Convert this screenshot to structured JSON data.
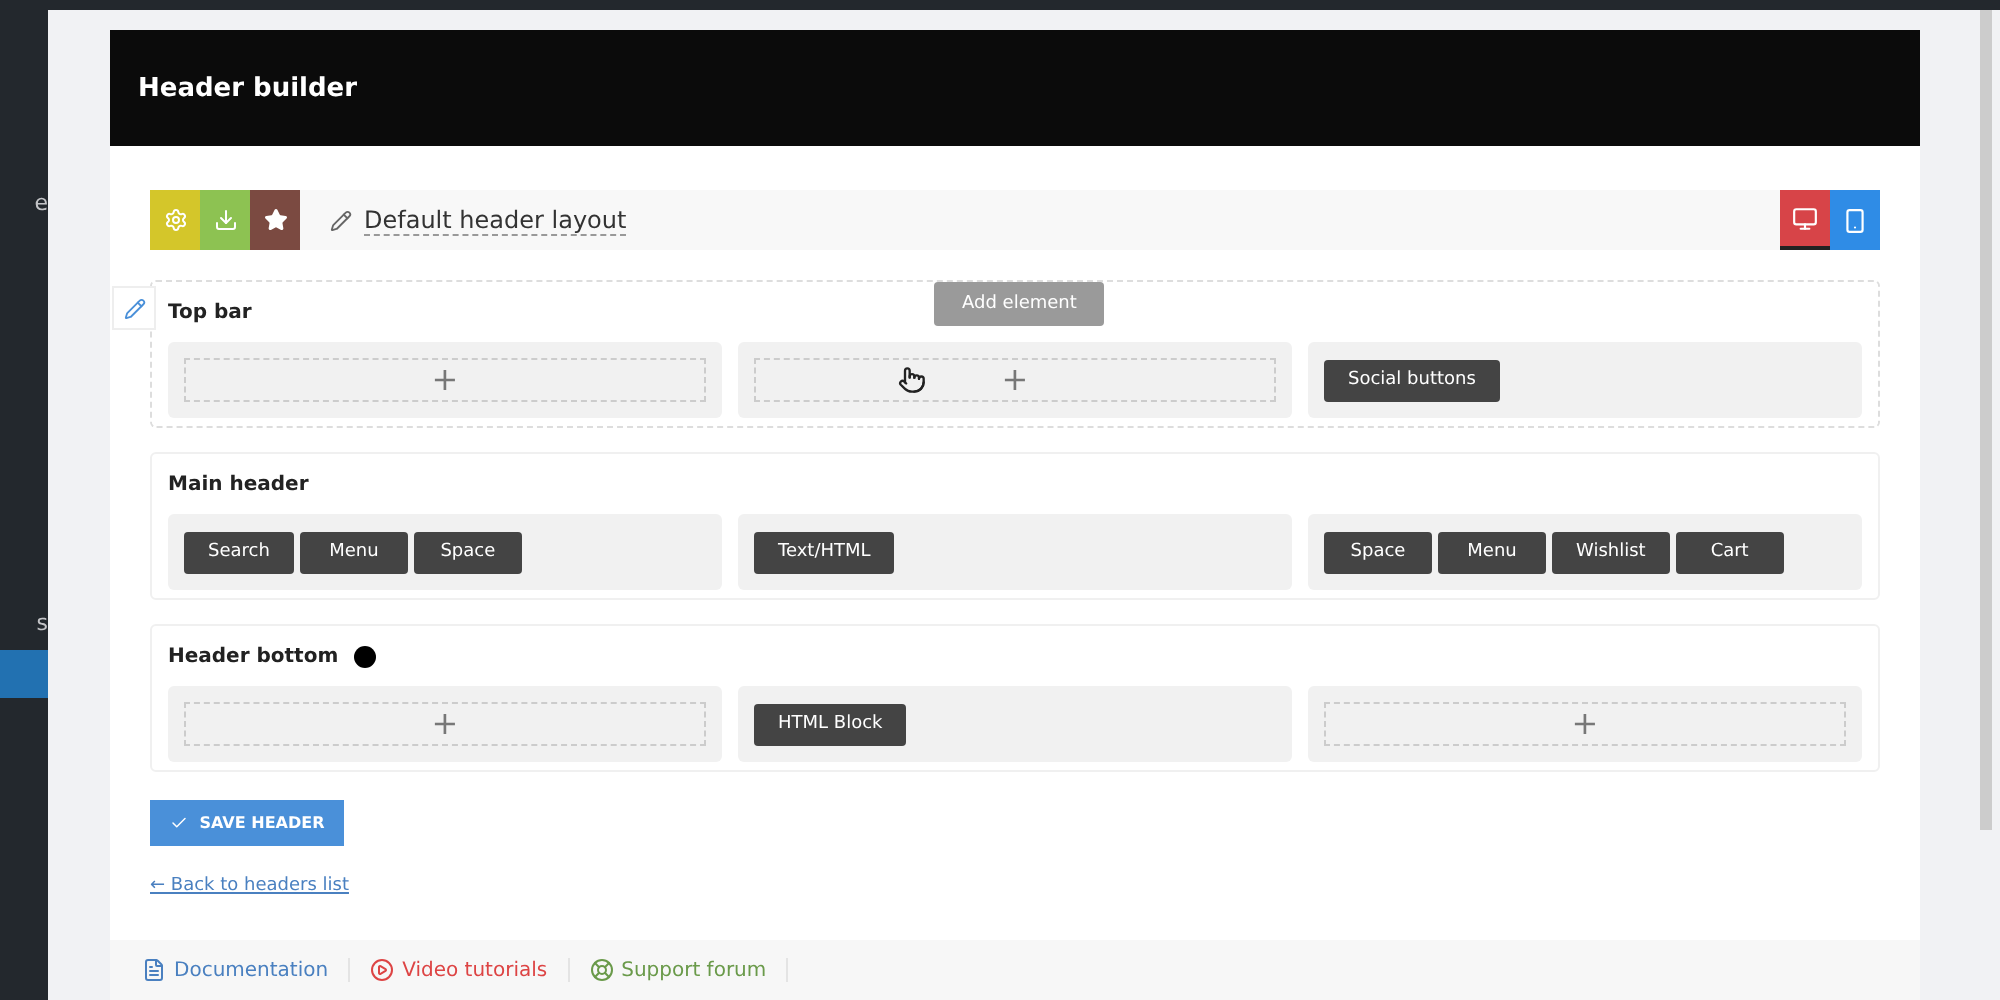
{
  "sidebar": {
    "items": [
      {
        "label": "e",
        "selected": false
      },
      {
        "label": "s",
        "selected": false
      },
      {
        "selected": true
      }
    ]
  },
  "panel_title": "Header builder",
  "toolbar": {
    "layout_name": "Default header layout",
    "left_buttons": [
      {
        "color": "#d4c62a"
      },
      {
        "color": "#8dc252"
      },
      {
        "color": "#7b4a41"
      }
    ],
    "devices": [
      {
        "kind": "desktop",
        "color": "#d74448",
        "selected": true
      },
      {
        "kind": "mobile",
        "color": "#2f8ce6",
        "selected": false
      }
    ]
  },
  "rows": [
    {
      "title": "Top bar",
      "editing": true,
      "dot": false,
      "columns": [
        {},
        {
          "tooltip": "Add element"
        },
        {
          "elements": [
            "Social buttons"
          ]
        }
      ]
    },
    {
      "title": "Main header",
      "editing": false,
      "dot": false,
      "columns": [
        {
          "elements": [
            "Search",
            "Menu",
            "Space"
          ]
        },
        {
          "elements": [
            "Text/HTML"
          ]
        },
        {
          "elements": [
            "Space",
            "Menu",
            "Wishlist",
            "Cart"
          ]
        }
      ]
    },
    {
      "title": "Header bottom",
      "editing": false,
      "dot": true,
      "columns": [
        {},
        {
          "elements": [
            "HTML Block"
          ]
        },
        {}
      ]
    }
  ],
  "add_symbol": "+",
  "save_button": "SAVE HEADER",
  "back_link": "← Back to headers list",
  "footer_links": [
    {
      "kind": "docs",
      "label": "Documentation"
    },
    {
      "kind": "video",
      "label": "Video tutorials"
    },
    {
      "kind": "forum",
      "label": "Support forum"
    }
  ]
}
